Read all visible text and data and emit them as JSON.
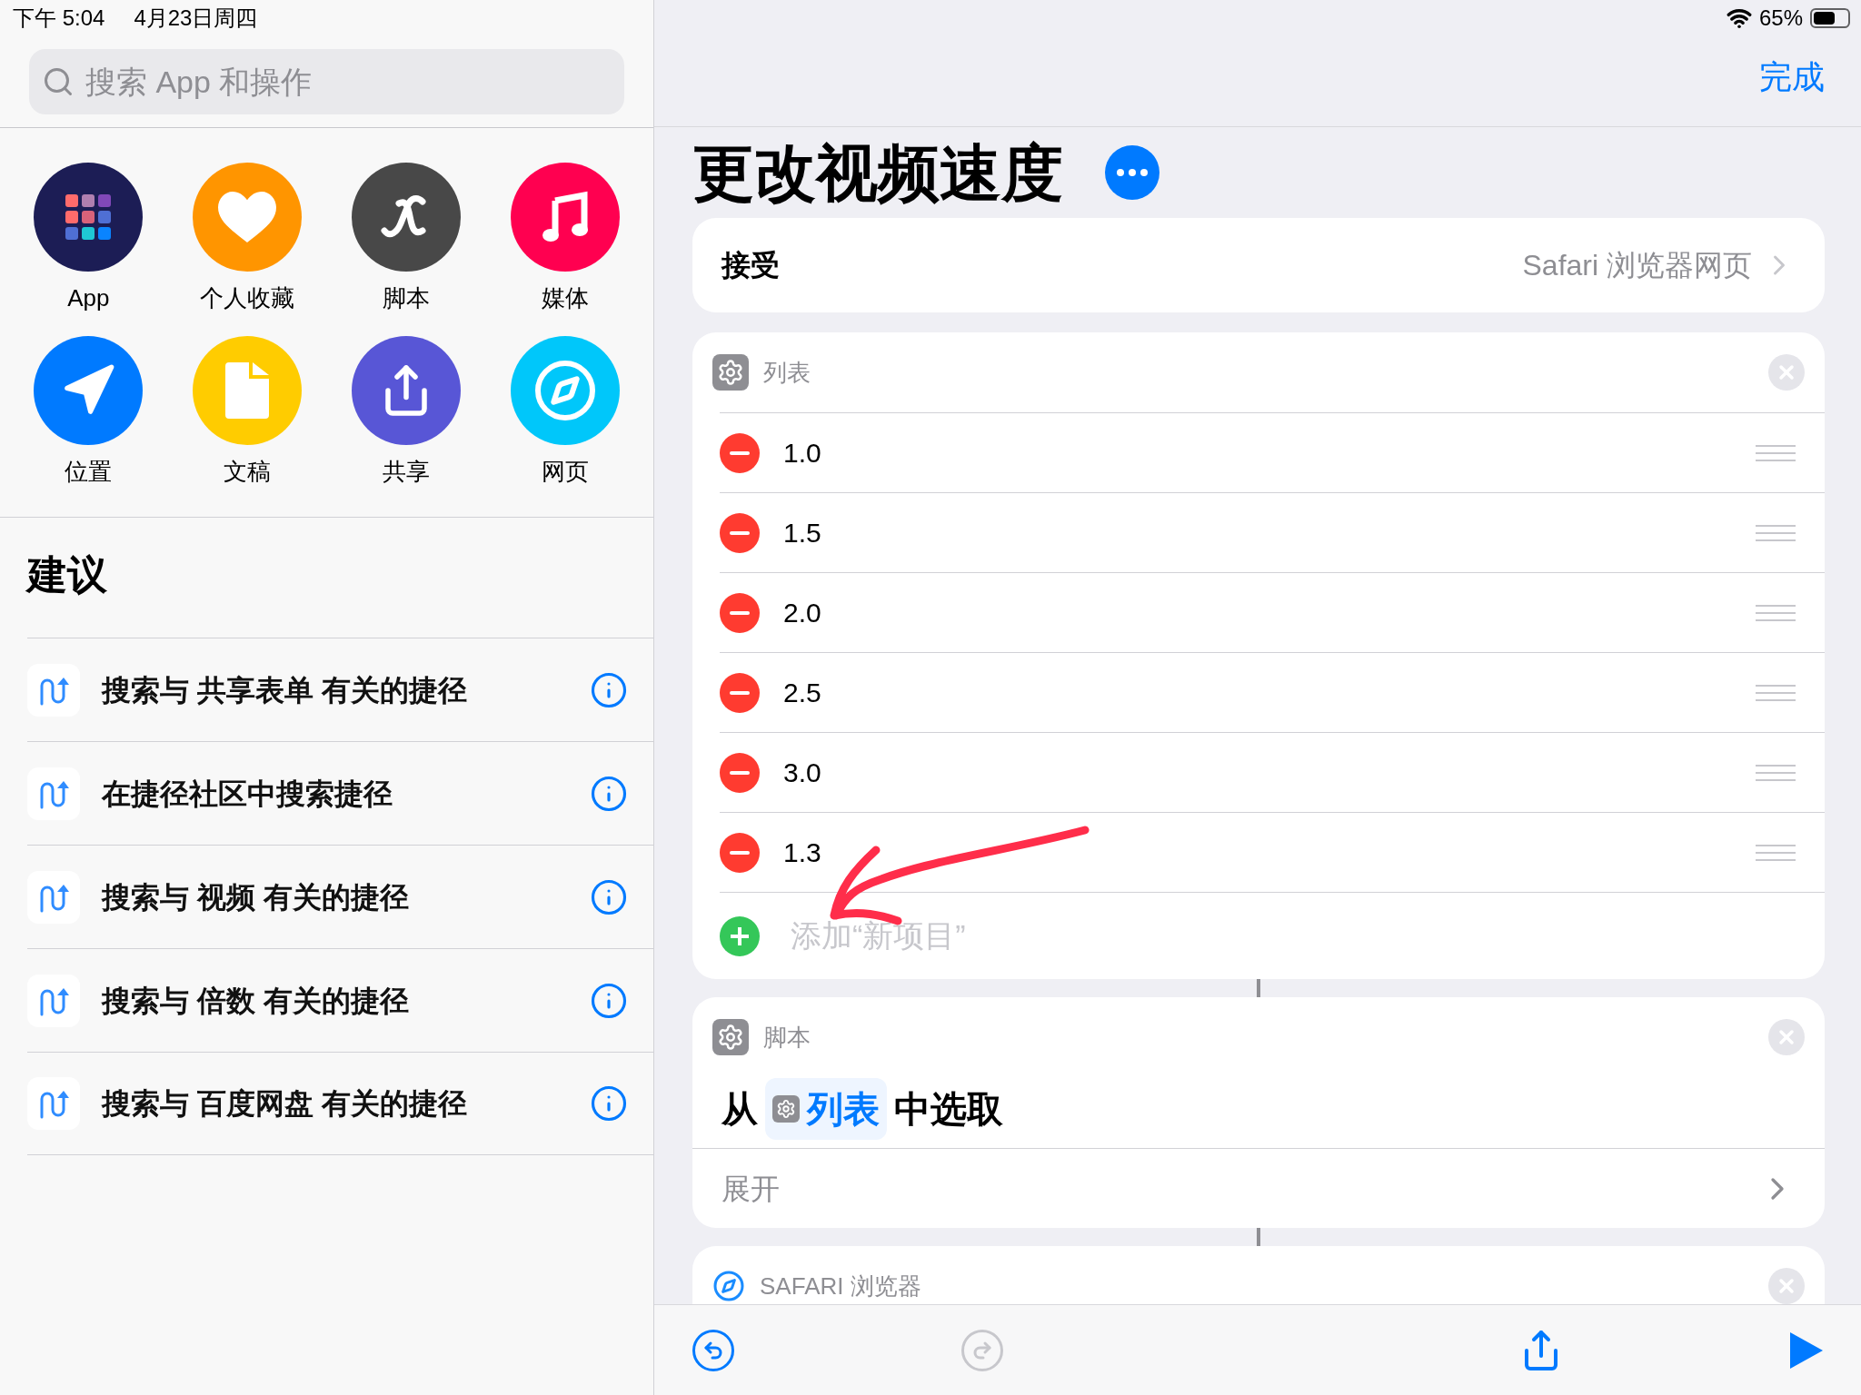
{
  "status_bar": {
    "time": "下午 5:04",
    "date": "4月23日周四",
    "battery": "65%"
  },
  "sidebar": {
    "search": {
      "placeholder": "搜索 App 和操作"
    },
    "categories": [
      {
        "label": "App",
        "kind": "apps",
        "color": "#1c1d55"
      },
      {
        "label": "个人收藏",
        "kind": "heart",
        "color": "#ff9500"
      },
      {
        "label": "脚本",
        "kind": "script",
        "color": "#484848"
      },
      {
        "label": "媒体",
        "kind": "music",
        "color": "#ff0050"
      },
      {
        "label": "位置",
        "kind": "location",
        "color": "#007aff"
      },
      {
        "label": "文稿",
        "kind": "document",
        "color": "#ffcc00"
      },
      {
        "label": "共享",
        "kind": "share",
        "color": "#5856d6"
      },
      {
        "label": "网页",
        "kind": "web",
        "color": "#00c7fa"
      }
    ],
    "suggestions_title": "建议",
    "suggestions": [
      "搜索与 共享表单 有关的捷径",
      "在捷径社区中搜索捷径",
      "搜索与 视频 有关的捷径",
      "搜索与 倍数 有关的捷径",
      "搜索与 百度网盘 有关的捷径"
    ]
  },
  "editor": {
    "done_button": "完成",
    "title": "更改视频速度",
    "receive": {
      "label": "接受",
      "value": "Safari 浏览器网页"
    },
    "actions": [
      {
        "kind": "list",
        "category": "列表",
        "items": [
          "1.0",
          "1.5",
          "2.0",
          "2.5",
          "3.0",
          "1.3"
        ],
        "add_label": "添加“新项目”"
      },
      {
        "kind": "choose",
        "category": "脚本",
        "text_before": "从",
        "variable": "列表",
        "text_after": "中选取",
        "expand": "展开"
      },
      {
        "kind": "safari",
        "category": "SAFARI 浏览器"
      }
    ]
  }
}
